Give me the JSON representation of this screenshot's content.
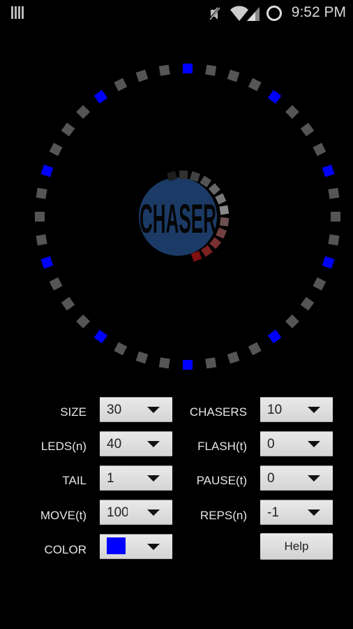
{
  "status_bar": {
    "time": "9:52 PM",
    "icons": [
      "notification-bars-icon",
      "mute-icon",
      "wifi-icon",
      "cell-signal-icon",
      "circle-icon"
    ]
  },
  "logo": {
    "text": "CHASER",
    "circle_color": "#1b3b66"
  },
  "ring": {
    "led_count": 40,
    "active_color": "#0000ff",
    "inactive_color": "#555555",
    "active_indices": [
      0,
      4,
      8,
      12,
      16,
      20,
      24,
      28,
      32,
      36
    ]
  },
  "controls": {
    "left": [
      {
        "label": "SIZE",
        "value": "30"
      },
      {
        "label": "LEDS(n)",
        "value": "40"
      },
      {
        "label": "TAIL",
        "value": "1"
      },
      {
        "label": "MOVE(t)",
        "value": "100"
      },
      {
        "label": "COLOR",
        "value": "",
        "swatch": "#0000ff"
      }
    ],
    "right": [
      {
        "label": "CHASERS",
        "value": "10"
      },
      {
        "label": "FLASH(t)",
        "value": "0"
      },
      {
        "label": "PAUSE(t)",
        "value": "0"
      },
      {
        "label": "REPS(n)",
        "value": "-1"
      }
    ],
    "help_label": "Help"
  }
}
